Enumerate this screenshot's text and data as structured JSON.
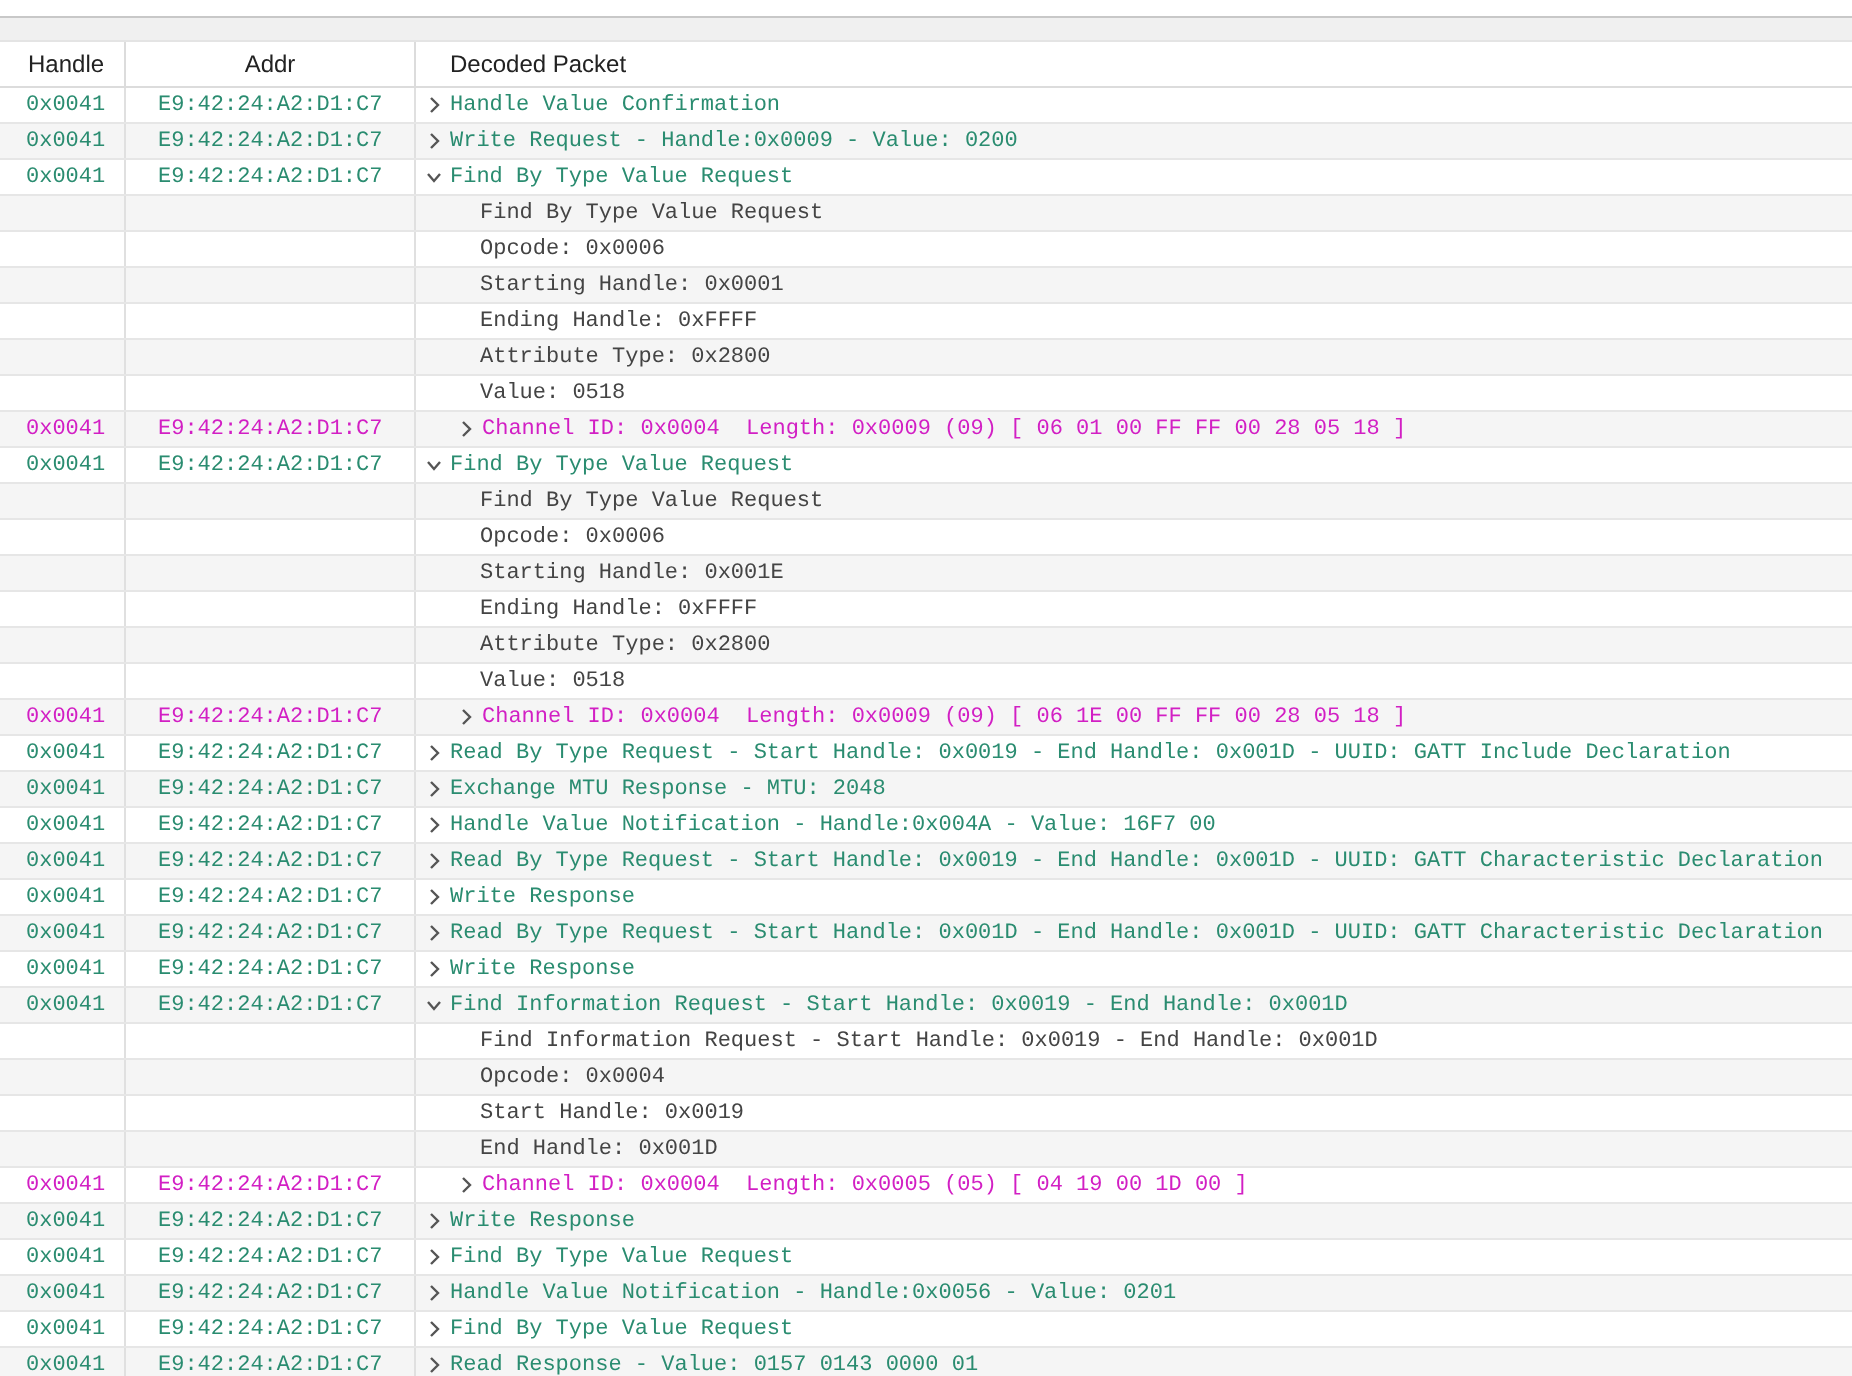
{
  "columns": [
    "Handle",
    "Addr",
    "Decoded Packet"
  ],
  "rows": [
    {
      "kind": "packet",
      "handle": "0x0041",
      "addr": "E9:42:24:A2:D1:C7",
      "expanded": false,
      "text": "Handle Value Confirmation"
    },
    {
      "kind": "packet",
      "handle": "0x0041",
      "addr": "E9:42:24:A2:D1:C7",
      "expanded": false,
      "text": "Write Request - Handle:0x0009 - Value: 0200"
    },
    {
      "kind": "packet",
      "handle": "0x0041",
      "addr": "E9:42:24:A2:D1:C7",
      "expanded": true,
      "text": "Find By Type Value Request"
    },
    {
      "kind": "detail",
      "text": "Find By Type Value Request"
    },
    {
      "kind": "detail",
      "text": "Opcode: 0x0006"
    },
    {
      "kind": "detail",
      "text": "Starting Handle: 0x0001"
    },
    {
      "kind": "detail",
      "text": "Ending Handle: 0xFFFF"
    },
    {
      "kind": "detail",
      "text": "Attribute Type: 0x2800"
    },
    {
      "kind": "detail",
      "text": "Value: 0518"
    },
    {
      "kind": "l2cap",
      "handle": "0x0041",
      "addr": "E9:42:24:A2:D1:C7",
      "expanded": false,
      "text": "Channel ID: 0x0004  Length: 0x0009 (09) [ 06 01 00 FF FF 00 28 05 18 ]"
    },
    {
      "kind": "packet",
      "handle": "0x0041",
      "addr": "E9:42:24:A2:D1:C7",
      "expanded": true,
      "text": "Find By Type Value Request"
    },
    {
      "kind": "detail",
      "text": "Find By Type Value Request"
    },
    {
      "kind": "detail",
      "text": "Opcode: 0x0006"
    },
    {
      "kind": "detail",
      "text": "Starting Handle: 0x001E"
    },
    {
      "kind": "detail",
      "text": "Ending Handle: 0xFFFF"
    },
    {
      "kind": "detail",
      "text": "Attribute Type: 0x2800"
    },
    {
      "kind": "detail",
      "text": "Value: 0518"
    },
    {
      "kind": "l2cap",
      "handle": "0x0041",
      "addr": "E9:42:24:A2:D1:C7",
      "expanded": false,
      "text": "Channel ID: 0x0004  Length: 0x0009 (09) [ 06 1E 00 FF FF 00 28 05 18 ]"
    },
    {
      "kind": "packet",
      "handle": "0x0041",
      "addr": "E9:42:24:A2:D1:C7",
      "expanded": false,
      "text": "Read By Type Request - Start Handle: 0x0019 - End Handle: 0x001D - UUID: GATT Include Declaration"
    },
    {
      "kind": "packet",
      "handle": "0x0041",
      "addr": "E9:42:24:A2:D1:C7",
      "expanded": false,
      "text": "Exchange MTU Response - MTU: 2048"
    },
    {
      "kind": "packet",
      "handle": "0x0041",
      "addr": "E9:42:24:A2:D1:C7",
      "expanded": false,
      "text": "Handle Value Notification - Handle:0x004A - Value: 16F7 00"
    },
    {
      "kind": "packet",
      "handle": "0x0041",
      "addr": "E9:42:24:A2:D1:C7",
      "expanded": false,
      "text": "Read By Type Request - Start Handle: 0x0019 - End Handle: 0x001D - UUID: GATT Characteristic Declaration"
    },
    {
      "kind": "packet",
      "handle": "0x0041",
      "addr": "E9:42:24:A2:D1:C7",
      "expanded": false,
      "text": "Write Response"
    },
    {
      "kind": "packet",
      "handle": "0x0041",
      "addr": "E9:42:24:A2:D1:C7",
      "expanded": false,
      "text": "Read By Type Request - Start Handle: 0x001D - End Handle: 0x001D - UUID: GATT Characteristic Declaration"
    },
    {
      "kind": "packet",
      "handle": "0x0041",
      "addr": "E9:42:24:A2:D1:C7",
      "expanded": false,
      "text": "Write Response"
    },
    {
      "kind": "packet",
      "handle": "0x0041",
      "addr": "E9:42:24:A2:D1:C7",
      "expanded": true,
      "text": "Find Information Request - Start Handle: 0x0019 - End Handle: 0x001D"
    },
    {
      "kind": "detail",
      "text": "Find Information Request - Start Handle: 0x0019 - End Handle: 0x001D"
    },
    {
      "kind": "detail",
      "text": "Opcode: 0x0004"
    },
    {
      "kind": "detail",
      "text": "Start Handle: 0x0019"
    },
    {
      "kind": "detail",
      "text": "End Handle: 0x001D"
    },
    {
      "kind": "l2cap",
      "handle": "0x0041",
      "addr": "E9:42:24:A2:D1:C7",
      "expanded": false,
      "text": "Channel ID: 0x0004  Length: 0x0005 (05) [ 04 19 00 1D 00 ]"
    },
    {
      "kind": "packet",
      "handle": "0x0041",
      "addr": "E9:42:24:A2:D1:C7",
      "expanded": false,
      "text": "Write Response"
    },
    {
      "kind": "packet",
      "handle": "0x0041",
      "addr": "E9:42:24:A2:D1:C7",
      "expanded": false,
      "text": "Find By Type Value Request"
    },
    {
      "kind": "packet",
      "handle": "0x0041",
      "addr": "E9:42:24:A2:D1:C7",
      "expanded": false,
      "text": "Handle Value Notification - Handle:0x0056 - Value: 0201"
    },
    {
      "kind": "packet",
      "handle": "0x0041",
      "addr": "E9:42:24:A2:D1:C7",
      "expanded": false,
      "text": "Find By Type Value Request"
    },
    {
      "kind": "packet",
      "handle": "0x0041",
      "addr": "E9:42:24:A2:D1:C7",
      "expanded": false,
      "text": "Read Response - Value: 0157 0143 0000 01"
    }
  ]
}
